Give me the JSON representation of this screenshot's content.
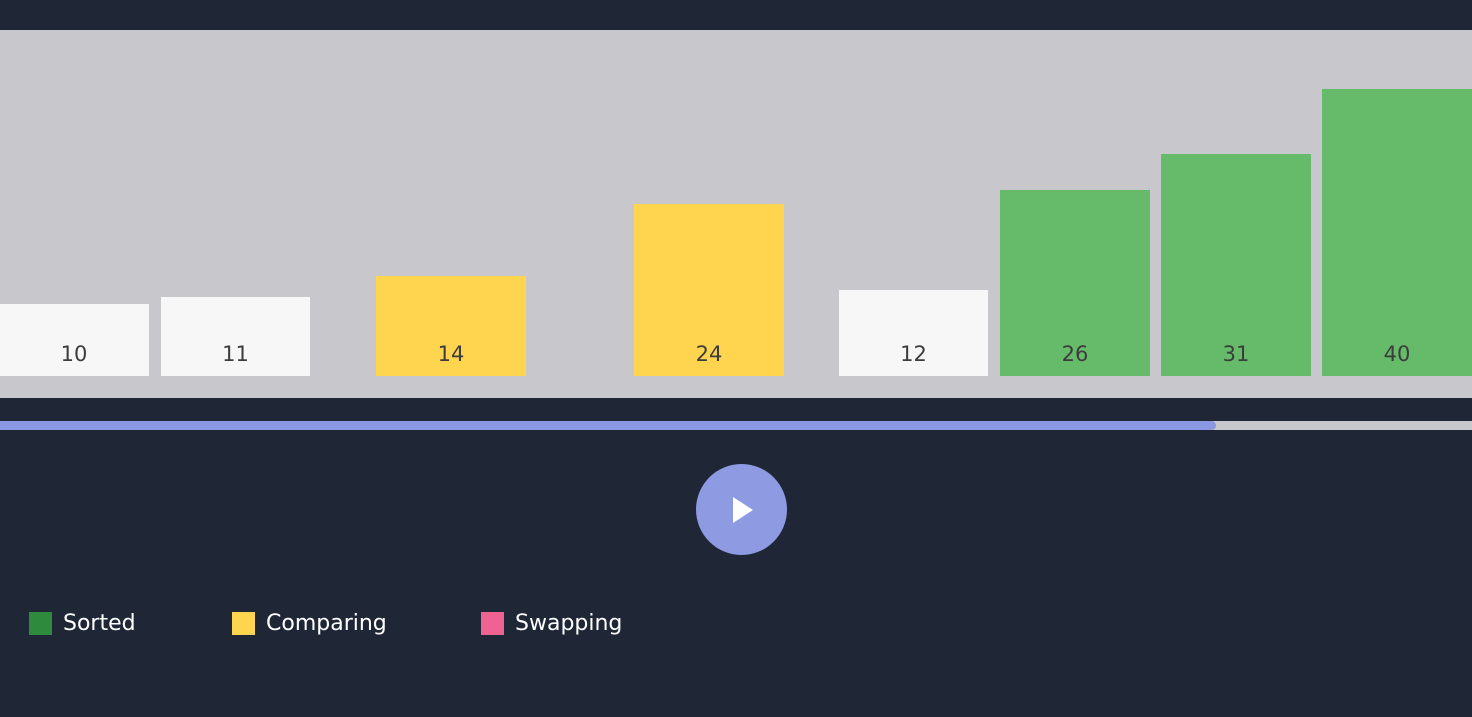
{
  "chart_data": {
    "type": "bar",
    "categories": [
      "10",
      "11",
      "14",
      "24",
      "12",
      "26",
      "31",
      "40"
    ],
    "values": [
      10,
      11,
      14,
      24,
      12,
      26,
      31,
      40
    ],
    "states": [
      "default",
      "default",
      "comparing",
      "comparing",
      "default",
      "sorted",
      "sorted",
      "sorted"
    ],
    "ylim": [
      0,
      40
    ]
  },
  "colors": {
    "default": "#f7f7f7",
    "comparing": "#ffd54f",
    "sorted": "#66bb6a",
    "swapping": "#f06292",
    "legend_sorted": "#2e8b3e",
    "progress": "#8a97e3",
    "play_button": "#8e9be3"
  },
  "progress": 0.826,
  "controls": {
    "play_icon": "play-icon"
  },
  "legend": [
    {
      "label": "Sorted",
      "color": "#2e8b3e"
    },
    {
      "label": "Comparing",
      "color": "#ffd54f"
    },
    {
      "label": "Swapping",
      "color": "#f06292"
    }
  ]
}
